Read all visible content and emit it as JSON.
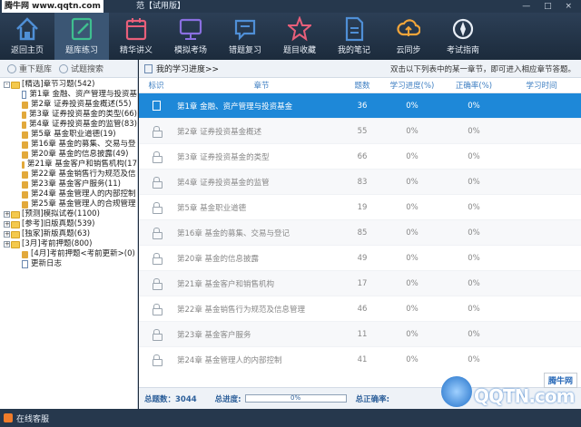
{
  "titlebar": {
    "brand": "腾牛网 www.qqtn.com",
    "title": "范【试用版】",
    "controls": "— □ ×"
  },
  "toolbar": {
    "items": [
      {
        "label": "返回主页",
        "icon": "home-icon",
        "color": "#4f8fd6"
      },
      {
        "label": "题库练习",
        "icon": "edit-icon",
        "color": "#3fbf8f"
      },
      {
        "label": "精华讲义",
        "icon": "calendar-icon",
        "color": "#e85f7a"
      },
      {
        "label": "模拟考场",
        "icon": "monitor-icon",
        "color": "#8a6fe0"
      },
      {
        "label": "错题复习",
        "icon": "chat-icon",
        "color": "#4f8fd6"
      },
      {
        "label": "题目收藏",
        "icon": "star-icon",
        "color": "#e85f7a"
      },
      {
        "label": "我的笔记",
        "icon": "document-icon",
        "color": "#4f8fd6"
      },
      {
        "label": "云同步",
        "icon": "cloud-sync-icon",
        "color": "#f2a53a"
      },
      {
        "label": "考试指南",
        "icon": "compass-icon",
        "color": "#e8eef6"
      }
    ],
    "active_index": 1
  },
  "left": {
    "tabs": [
      "重下题库",
      "试题搜索"
    ],
    "tree": [
      {
        "level": 0,
        "exp": "-",
        "icon": "folder",
        "text": "[精选]章节习题(542)"
      },
      {
        "level": 1,
        "icon": "doc",
        "text": "第1章 金融、资产管理与投资基"
      },
      {
        "level": 1,
        "icon": "lock",
        "text": "第2章 证券投资基金概述(55)"
      },
      {
        "level": 1,
        "icon": "lock",
        "text": "第3章 证券投资基金的类型(66)"
      },
      {
        "level": 1,
        "icon": "lock",
        "text": "第4章 证券投资基金的监管(83)"
      },
      {
        "level": 1,
        "icon": "lock",
        "text": "第5章 基金职业道德(19)"
      },
      {
        "level": 1,
        "icon": "lock",
        "text": "第16章 基金的募集、交易与登"
      },
      {
        "level": 1,
        "icon": "lock",
        "text": "第20章 基金的信息披露(49)"
      },
      {
        "level": 1,
        "icon": "lock",
        "text": "第21章 基金客户和销售机构(17"
      },
      {
        "level": 1,
        "icon": "lock",
        "text": "第22章 基金销售行为规范及信"
      },
      {
        "level": 1,
        "icon": "lock",
        "text": "第23章 基金客户服务(11)"
      },
      {
        "level": 1,
        "icon": "lock",
        "text": "第24章 基金管理人的内部控制"
      },
      {
        "level": 1,
        "icon": "lock",
        "text": "第25章 基金管理人的合规管理"
      },
      {
        "level": 0,
        "exp": "+",
        "icon": "folder",
        "text": "[预测]模拟试卷(1100)"
      },
      {
        "level": 0,
        "exp": "+",
        "icon": "folder",
        "text": "[参考]旧版真题(539)"
      },
      {
        "level": 0,
        "exp": "+",
        "icon": "folder",
        "text": "[独家]新版真题(63)"
      },
      {
        "level": 0,
        "exp": "+",
        "icon": "folder",
        "text": "[3月]考前押题(800)"
      },
      {
        "level": 1,
        "icon": "lock",
        "text": "[4月]考前押题<考前更新>(0)"
      },
      {
        "level": 1,
        "icon": "doc",
        "text": "更新日志"
      }
    ]
  },
  "right": {
    "title": "我的学习进度>>",
    "hint": "双击以下列表中的某一章节，即可进入相应章节答题。",
    "columns": [
      "标识",
      "章节",
      "题数",
      "学习进度(%)",
      "正确率(%)",
      "学习时间"
    ],
    "rows": [
      {
        "chapter": "第1章 金融、资产管理与投资基金",
        "count": "36",
        "progress": "0%",
        "rate": "0%",
        "time": "",
        "selected": true
      },
      {
        "chapter": "第2章 证券投资基金概述",
        "count": "55",
        "progress": "0%",
        "rate": "0%",
        "time": ""
      },
      {
        "chapter": "第3章 证券投资基金的类型",
        "count": "66",
        "progress": "0%",
        "rate": "0%",
        "time": ""
      },
      {
        "chapter": "第4章 证券投资基金的监管",
        "count": "83",
        "progress": "0%",
        "rate": "0%",
        "time": ""
      },
      {
        "chapter": "第5章 基金职业道德",
        "count": "19",
        "progress": "0%",
        "rate": "0%",
        "time": ""
      },
      {
        "chapter": "第16章 基金的募集、交易与登记",
        "count": "85",
        "progress": "0%",
        "rate": "0%",
        "time": ""
      },
      {
        "chapter": "第20章 基金的信息披露",
        "count": "49",
        "progress": "0%",
        "rate": "0%",
        "time": ""
      },
      {
        "chapter": "第21章 基金客户和销售机构",
        "count": "17",
        "progress": "0%",
        "rate": "0%",
        "time": ""
      },
      {
        "chapter": "第22章 基金销售行为规范及信息管理",
        "count": "46",
        "progress": "0%",
        "rate": "0%",
        "time": ""
      },
      {
        "chapter": "第23章 基金客户服务",
        "count": "11",
        "progress": "0%",
        "rate": "0%",
        "time": ""
      },
      {
        "chapter": "第24章 基金管理人的内部控制",
        "count": "41",
        "progress": "0%",
        "rate": "0%",
        "time": ""
      }
    ],
    "footer": {
      "total_label": "总题数：3044",
      "progress_label": "总进度:",
      "progress_value": "0%",
      "progress_fraction": 0,
      "rate_label": "总正确率:"
    }
  },
  "statusbar": {
    "text": "在线客服"
  },
  "watermark": {
    "badge": "腾牛网",
    "logo": "QQTN.com"
  }
}
